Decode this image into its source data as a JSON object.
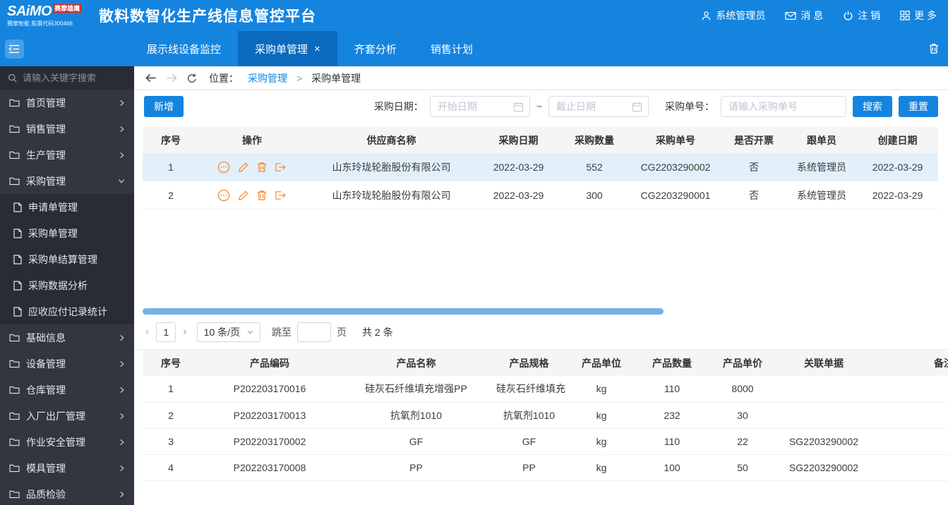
{
  "colors": {
    "primary_blue": "#1584df",
    "active_tab_blue": "#0b6abe",
    "sidebar_bg": "#32363f",
    "sidebar_submenu_bg": "#282c35",
    "selected_row_bg": "#e2f0fc",
    "operation_icon_orange": "#f78b2d",
    "link_blue": "#1584df",
    "scrollbar_blue": "#77b1e6",
    "badge_red": "#e7271d"
  },
  "header": {
    "brand": "SAiMO",
    "brand_badge": "赛摩雄鹰",
    "brand_sub": "赛摩智能 股票代码300466",
    "title": "散料数智化生产线信息管控平台",
    "user": "系统管理员",
    "messages": "消 息",
    "logout": "注 销",
    "more": "更 多"
  },
  "tabbar": {
    "tabs": [
      {
        "label": "展示线设备监控",
        "active": false
      },
      {
        "label": "采购单管理",
        "active": true
      },
      {
        "label": "齐套分析",
        "active": false
      },
      {
        "label": "销售计划",
        "active": false
      }
    ],
    "close_glyph": "×"
  },
  "sidebar": {
    "search_placeholder": "请输入关键字搜索",
    "menu": [
      {
        "label": "首页管理"
      },
      {
        "label": "销售管理"
      },
      {
        "label": "生产管理"
      },
      {
        "label": "采购管理",
        "expanded": true
      },
      {
        "label": "基础信息"
      },
      {
        "label": "设备管理"
      },
      {
        "label": "仓库管理"
      },
      {
        "label": "入厂出厂管理"
      },
      {
        "label": "作业安全管理"
      },
      {
        "label": "模具管理"
      },
      {
        "label": "品质检验"
      }
    ],
    "purchase_submenu": [
      "申请单管理",
      "采购单管理",
      "采购单结算管理",
      "采购数据分析",
      "应收应付记录统计"
    ]
  },
  "breadcrumb": {
    "prefix": "位置：",
    "parent": "采购管理",
    "separator": ">",
    "current": "采购单管理"
  },
  "toolbar": {
    "add_label": "新增",
    "date_label": "采购日期：",
    "start_placeholder": "开始日期",
    "range_separator": "~",
    "end_placeholder": "截止日期",
    "order_label": "采购单号：",
    "order_placeholder": "请输入采购单号",
    "search_label": "搜索",
    "reset_label": "重置"
  },
  "orders_table": {
    "headers": [
      "序号",
      "操作",
      "供应商名称",
      "采购日期",
      "采购数量",
      "采购单号",
      "是否开票",
      "跟单员",
      "创建日期"
    ],
    "rows": [
      {
        "seq": "1",
        "supplier": "山东玲珑轮胎股份有限公司",
        "purchase_date": "2022-03-29",
        "quantity": "552",
        "order_no": "CG2203290002",
        "invoiced": "否",
        "follower": "系统管理员",
        "created": "2022-03-29",
        "selected": true
      },
      {
        "seq": "2",
        "supplier": "山东玲珑轮胎股份有限公司",
        "purchase_date": "2022-03-29",
        "quantity": "300",
        "order_no": "CG2203290001",
        "invoiced": "否",
        "follower": "系统管理员",
        "created": "2022-03-29",
        "selected": false
      }
    ]
  },
  "pagination": {
    "prev_glyph": "‹",
    "page": "1",
    "next_glyph": "›",
    "page_size": "10 条/页",
    "jump_label": "跳至",
    "page_unit": "页",
    "total": "共 2 条"
  },
  "products_table": {
    "headers": [
      "序号",
      "产品编码",
      "产品名称",
      "产品规格",
      "产品单位",
      "产品数量",
      "产品单价",
      "关联单据",
      "备注"
    ],
    "rows": [
      {
        "seq": "1",
        "code": "P202203170016",
        "name": "硅灰石纤维填充增强PP",
        "spec": "硅灰石纤维填充...",
        "unit": "kg",
        "quantity": "110",
        "price": "8000",
        "related_doc": ""
      },
      {
        "seq": "2",
        "code": "P202203170013",
        "name": "抗氧剂1010",
        "spec": "抗氧剂1010",
        "unit": "kg",
        "quantity": "232",
        "price": "30",
        "related_doc": ""
      },
      {
        "seq": "3",
        "code": "P202203170002",
        "name": "GF",
        "spec": "GF",
        "unit": "kg",
        "quantity": "110",
        "price": "22",
        "related_doc": "SG2203290002"
      },
      {
        "seq": "4",
        "code": "P202203170008",
        "name": "PP",
        "spec": "PP",
        "unit": "kg",
        "quantity": "100",
        "price": "50",
        "related_doc": "SG2203290002"
      }
    ]
  }
}
